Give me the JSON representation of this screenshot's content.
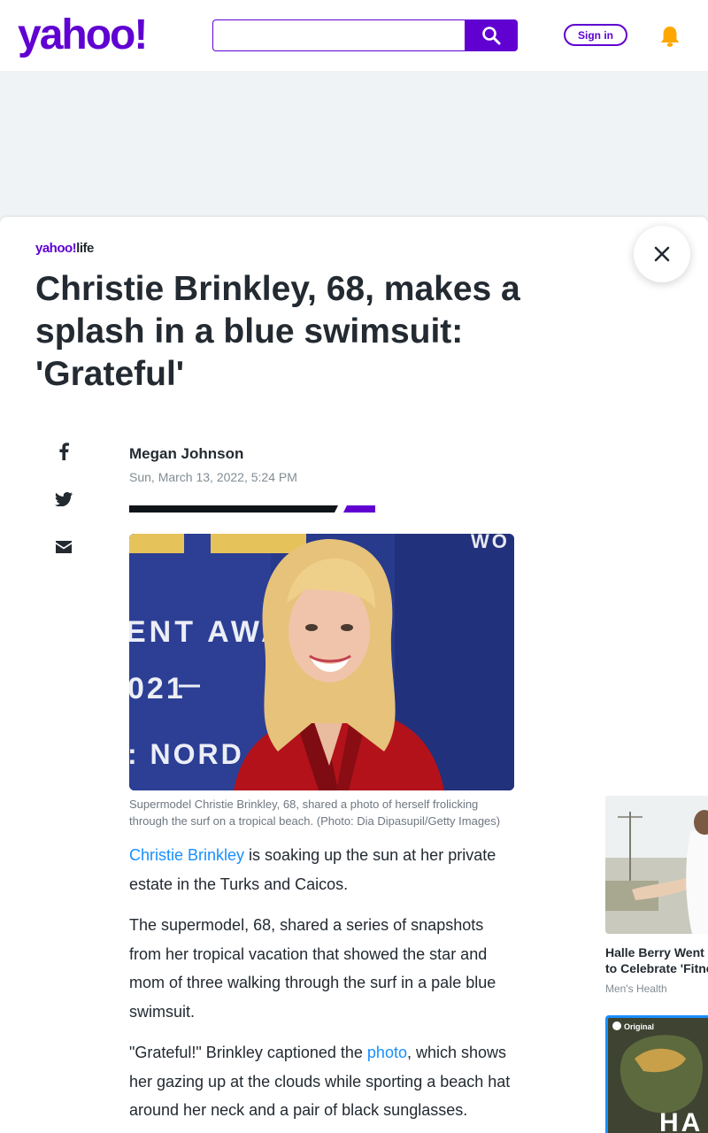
{
  "header": {
    "logo": "yahoo!",
    "search": {
      "value": "",
      "placeholder": ""
    },
    "signin_label": "Sign in"
  },
  "article": {
    "brand": {
      "name": "yahoo!",
      "section": "life"
    },
    "title": "Christie Brinkley, 68, makes a splash in a blue swimsuit: 'Grateful'",
    "author": "Megan Johnson",
    "date": "Sun, March 13, 2022, 5:24 PM",
    "photo_backdrop_text": {
      "line1": "WO",
      "line2": "ENT AWA",
      "line3": "021",
      "line4": ": NORD"
    },
    "caption": "Supermodel Christie Brinkley, 68, shared a photo of herself frolicking through the surf on a tropical beach. (Photo: Dia Dipasupil/Getty Images)",
    "p1": {
      "link": "Christie Brinkley",
      "text": " is soaking up the sun at her private estate in the Turks and Caicos."
    },
    "p2": {
      "text": "The supermodel, 68, shared a series of snapshots from her tropical vacation that showed the star and mom of three walking through the surf in a pale blue swimsuit."
    },
    "p3": {
      "before": "\"Grateful!\" Brinkley captioned the ",
      "link": "photo",
      "after": ", which shows her gazing up at the clouds while sporting a beach hat around her neck and a pair of black sunglasses."
    }
  },
  "share": [
    "facebook-icon",
    "twitter-icon",
    "mail-icon"
  ],
  "sidebar": {
    "rec1": {
      "title_line1": "Halle Berry Went",
      "title_line2": "to Celebrate 'Fitne",
      "source": "Men's Health"
    },
    "rec2": {
      "badge": "Original",
      "overlay": "HA"
    }
  },
  "colors": {
    "brand": "#6001d2",
    "link": "#188fff",
    "text": "#232a31",
    "muted": "#828c93"
  }
}
